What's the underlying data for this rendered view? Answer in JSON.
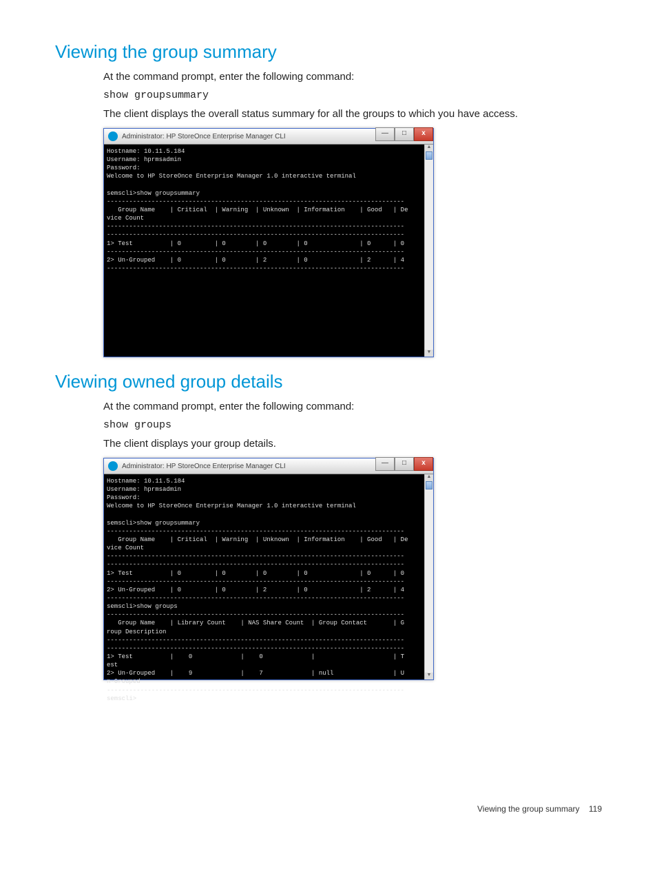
{
  "section1": {
    "title": "Viewing the group summary",
    "intro": "At the command prompt, enter the following command:",
    "command": "show groupsummary",
    "result_text": "The client displays the overall status summary for all the groups to which you have access."
  },
  "section2": {
    "title": "Viewing owned group details",
    "intro": "At the command prompt, enter the following command:",
    "command": "show groups",
    "result_text": "The client displays your group details."
  },
  "terminal_window": {
    "title": "Administrator: HP StoreOnce Enterprise Manager CLI",
    "min_label": "—",
    "max_label": "□",
    "close_label": "x"
  },
  "term1_content": "Hostname: 10.11.5.184\nUsername: hprmsadmin\nPassword:\nWelcome to HP StoreOnce Enterprise Manager 1.0 interactive terminal\n\nsemscli>show groupsummary\n--------------------------------------------------------------------------------\n   Group Name    | Critical  | Warning  | Unknown  | Information    | Good   | De\nvice Count\n--------------------------------------------------------------------------------\n--------------------------------------------------------------------------------\n1> Test          | 0         | 0        | 0        | 0              | 0      | 0\n--------------------------------------------------------------------------------\n2> Un-Grouped    | 0         | 0        | 2        | 0              | 2      | 4\n--------------------------------------------------------------------------------",
  "term2_content": "Hostname: 10.11.5.184\nUsername: hprmsadmin\nPassword:\nWelcome to HP StoreOnce Enterprise Manager 1.0 interactive terminal\n\nsemscli>show groupsummary\n--------------------------------------------------------------------------------\n   Group Name    | Critical  | Warning  | Unknown  | Information    | Good   | De\nvice Count\n--------------------------------------------------------------------------------\n--------------------------------------------------------------------------------\n1> Test          | 0         | 0        | 0        | 0              | 0      | 0\n--------------------------------------------------------------------------------\n2> Un-Grouped    | 0         | 0        | 2        | 0              | 2      | 4\n--------------------------------------------------------------------------------\nsemscli>show groups\n--------------------------------------------------------------------------------\n   Group Name    | Library Count    | NAS Share Count  | Group Contact       | G\nroup Description\n--------------------------------------------------------------------------------\n--------------------------------------------------------------------------------\n1> Test          |    0             |    0             |                     | T\nest\n2> Un-Grouped    |    9             |    7             | null                | U\nn-Grouped\n--------------------------------------------------------------------------------\nsemscli>",
  "chart_data": {
    "type": "table",
    "tables": [
      {
        "command": "show groupsummary",
        "columns": [
          "Group Name",
          "Critical",
          "Warning",
          "Unknown",
          "Information",
          "Good",
          "Device Count"
        ],
        "rows": [
          [
            "Test",
            0,
            0,
            0,
            0,
            0,
            0
          ],
          [
            "Un-Grouped",
            0,
            0,
            2,
            0,
            2,
            4
          ]
        ]
      },
      {
        "command": "show groups",
        "columns": [
          "Group Name",
          "Library Count",
          "NAS Share Count",
          "Group Contact",
          "Group Description"
        ],
        "rows": [
          [
            "Test",
            0,
            0,
            "",
            "Test"
          ],
          [
            "Un-Grouped",
            9,
            7,
            "null",
            "Un-Grouped"
          ]
        ]
      }
    ]
  },
  "footer": {
    "label": "Viewing the group summary",
    "page": "119"
  }
}
